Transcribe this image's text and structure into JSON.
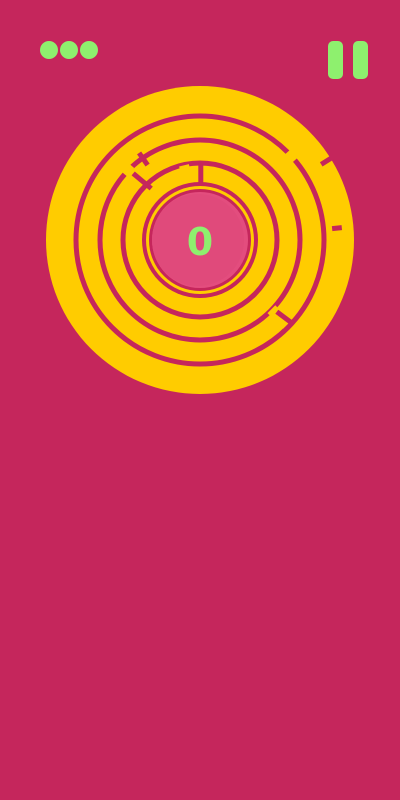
{
  "game": {
    "lives": 3,
    "score": "0"
  },
  "controls": {
    "pause_icon": "pause-icon"
  },
  "colors": {
    "background": "#C5265C",
    "ring": "#FFCC00",
    "accent": "#8EF06E",
    "center_ball": "#E34D7E"
  }
}
